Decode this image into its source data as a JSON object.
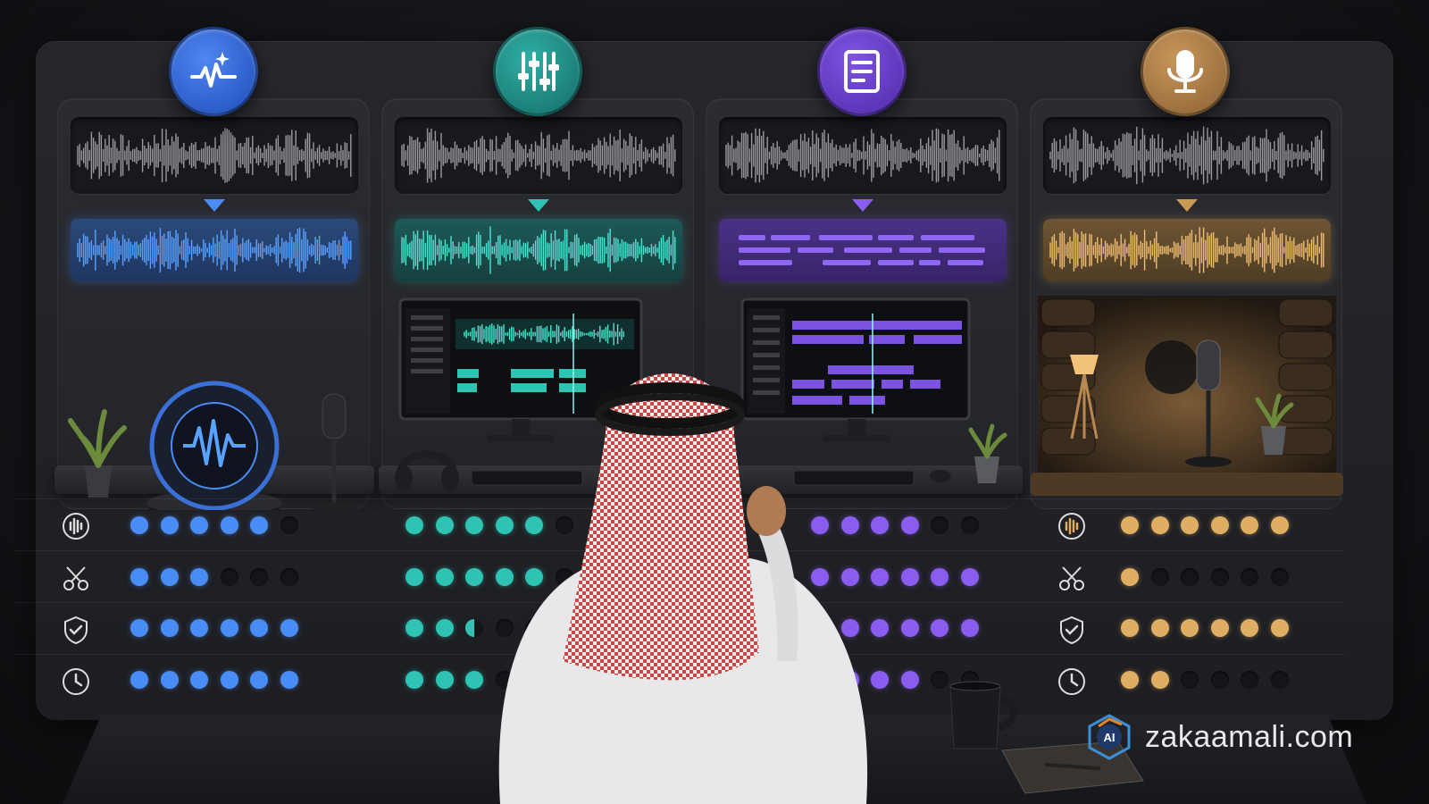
{
  "brand": {
    "domain": "zakaamali.com",
    "logo_text": "AI"
  },
  "columns": [
    {
      "id": "enhance",
      "icon": "waveform-sparkle-icon",
      "accent": "#4a8cf5",
      "scene": "smart-speaker"
    },
    {
      "id": "mix",
      "icon": "sliders-icon",
      "accent": "#2fc3b4",
      "scene": "editor-monitor"
    },
    {
      "id": "transcribe",
      "icon": "document-icon",
      "accent": "#8a5cf0",
      "scene": "transcript-monitor"
    },
    {
      "id": "record",
      "icon": "microphone-icon",
      "accent": "#e0ae62",
      "scene": "vocal-booth"
    }
  ],
  "criteria": [
    {
      "icon": "waveform-icon"
    },
    {
      "icon": "scissors-icon"
    },
    {
      "icon": "shield-check-icon"
    },
    {
      "icon": "clock-icon"
    }
  ],
  "ratings": [
    [
      5,
      5,
      4,
      6
    ],
    [
      3,
      5,
      6,
      1
    ],
    [
      6,
      2.5,
      6,
      6
    ],
    [
      6,
      3,
      4,
      2
    ]
  ],
  "rating_scale_max": 6
}
